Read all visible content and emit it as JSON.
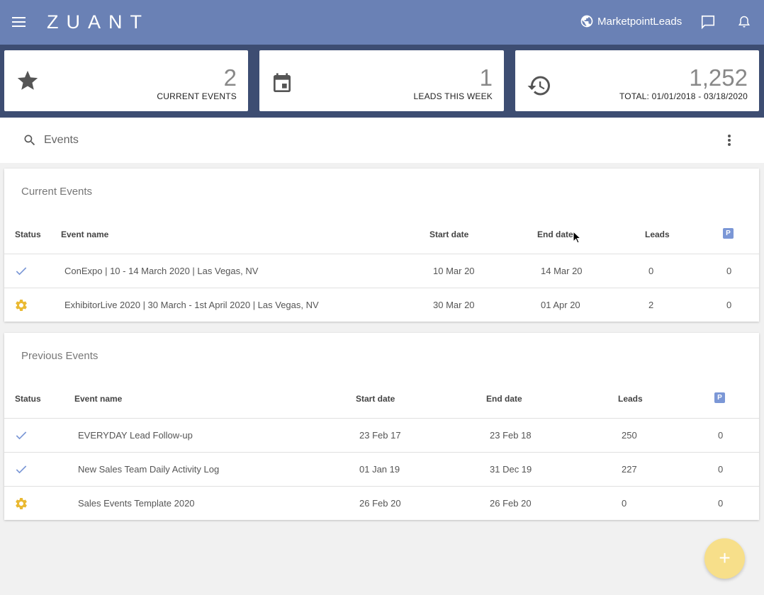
{
  "header": {
    "logo": "ZUANT",
    "account_name": "MarketpointLeads",
    "colors": {
      "topbar": "#6a81b5",
      "band": "#3d4d72"
    }
  },
  "stats": [
    {
      "icon": "star-icon",
      "value": "2",
      "label": "CURRENT EVENTS"
    },
    {
      "icon": "calendar-icon",
      "value": "1",
      "label": "LEADS THIS WEEK"
    },
    {
      "icon": "history-icon",
      "value": "1,252",
      "label": "TOTAL: 01/01/2018 - 03/18/2020"
    }
  ],
  "search": {
    "placeholder": "Events"
  },
  "current_events": {
    "title": "Current Events",
    "columns": {
      "status": "Status",
      "name": "Event name",
      "start": "Start date",
      "end": "End date",
      "leads": "Leads",
      "p": "P"
    },
    "rows": [
      {
        "status": "check",
        "name": "ConExpo | 10 - 14 March 2020 | Las Vegas, NV",
        "start": "10 Mar 20",
        "end": "14 Mar 20",
        "leads": "0",
        "p": "0"
      },
      {
        "status": "gear",
        "name": "ExhibitorLive 2020 | 30 March - 1st April 2020 | Las Vegas, NV",
        "start": "30 Mar 20",
        "end": "01 Apr 20",
        "leads": "2",
        "p": "0"
      }
    ]
  },
  "previous_events": {
    "title": "Previous Events",
    "columns": {
      "status": "Status",
      "name": "Event name",
      "start": "Start date",
      "end": "End date",
      "leads": "Leads",
      "p": "P"
    },
    "rows": [
      {
        "status": "check",
        "name": "EVERYDAY Lead Follow-up",
        "start": "23 Feb 17",
        "end": "23 Feb 18",
        "leads": "250",
        "p": "0"
      },
      {
        "status": "check",
        "name": "New Sales Team Daily Activity Log",
        "start": "01 Jan 19",
        "end": "31 Dec 19",
        "leads": "227",
        "p": "0"
      },
      {
        "status": "gear",
        "name": "Sales Events Template 2020",
        "start": "26 Feb 20",
        "end": "26 Feb 20",
        "leads": "0",
        "p": "0"
      }
    ]
  },
  "fab": {
    "label": "+"
  }
}
